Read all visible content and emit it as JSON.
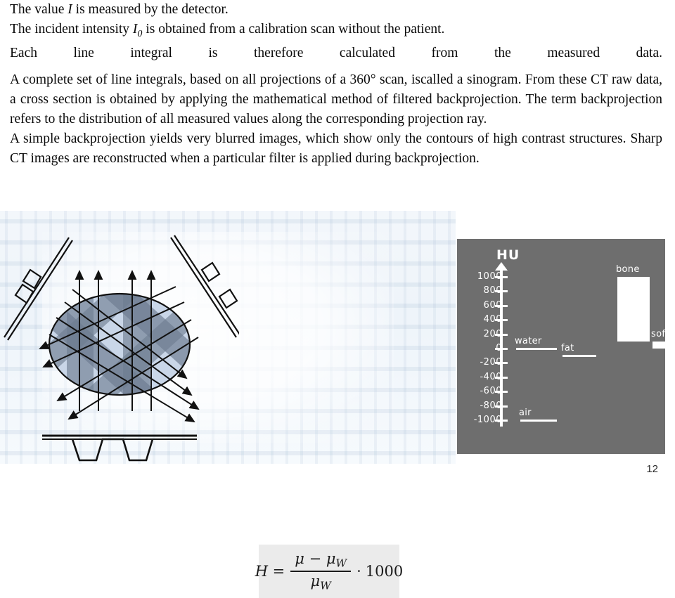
{
  "document": {
    "page_number": "12",
    "paragraphs": [
      {
        "id": "p1l1",
        "text_before": "The value ",
        "italic": "I",
        "text_after": " is measured by the detector."
      },
      {
        "id": "p1l2",
        "text_before": "The incident intensity ",
        "italic": "I",
        "subscript": "0",
        "text_after": " is obtained from a calibration scan without the patient."
      },
      {
        "id": "p1l3",
        "text": "Each line integral is therefore calculated from the measured data."
      }
    ],
    "body_paragraph": "A complete set of line integrals, based on all projections of a 360° scan, iscalled a sinogram. From these CT raw data, a cross section is obtained by applying the mathematical method of filtered backprojection. The term backprojection refers to the distribution of all measured values along the corresponding projection ray.",
    "body_paragraph_2": " A simple backprojection yields very blurred images, which show only the contours of high contrast structures. Sharp CT images are reconstructed when a particular filter is applied during backprojection."
  },
  "formula": {
    "lhs": "H",
    "equals": "=",
    "numerator_mu": "μ",
    "numerator_minus": "−",
    "numerator_muw": "μ",
    "numerator_muw_sub": "W",
    "denominator_mu": "μ",
    "denominator_sub": "W",
    "multiplier_dot": "·",
    "multiplier": "1000"
  },
  "ct_figure": {
    "caption": "",
    "description": "backprojection diagram: three projection ray bundles crossing an elliptical object with detector profiles"
  },
  "chart_data": {
    "type": "bar",
    "title": "HU",
    "xlabel": "",
    "ylabel": "HU",
    "ylim": [
      -1100,
      1100
    ],
    "grid": false,
    "legend": "none",
    "tick_labels": [
      "1000",
      "800",
      "600",
      "400",
      "200",
      "0",
      "-200",
      "-400",
      "-600",
      "-800",
      "-1000"
    ],
    "tick_values": [
      1000,
      800,
      600,
      400,
      200,
      0,
      -200,
      -400,
      -600,
      -800,
      -1000
    ],
    "categories": [
      "water",
      "fat",
      "bone",
      "soft tissue",
      "air"
    ],
    "items": [
      {
        "label": "water",
        "shape": "line",
        "value": 0,
        "low": 0,
        "high": 0
      },
      {
        "label": "fat",
        "shape": "line",
        "value": -100,
        "low": -100,
        "high": -100
      },
      {
        "label": "bone",
        "shape": "bar",
        "low": 100,
        "high": 1000,
        "value": 550
      },
      {
        "label": "soft tissue",
        "shape": "bar",
        "low": 0,
        "high": 100,
        "value": 50
      },
      {
        "label": "air",
        "shape": "line",
        "value": -1000,
        "low": -1000,
        "high": -1000
      }
    ],
    "axis_colors": {
      "background": "#6e6e6e",
      "foreground": "#ffffff"
    }
  }
}
